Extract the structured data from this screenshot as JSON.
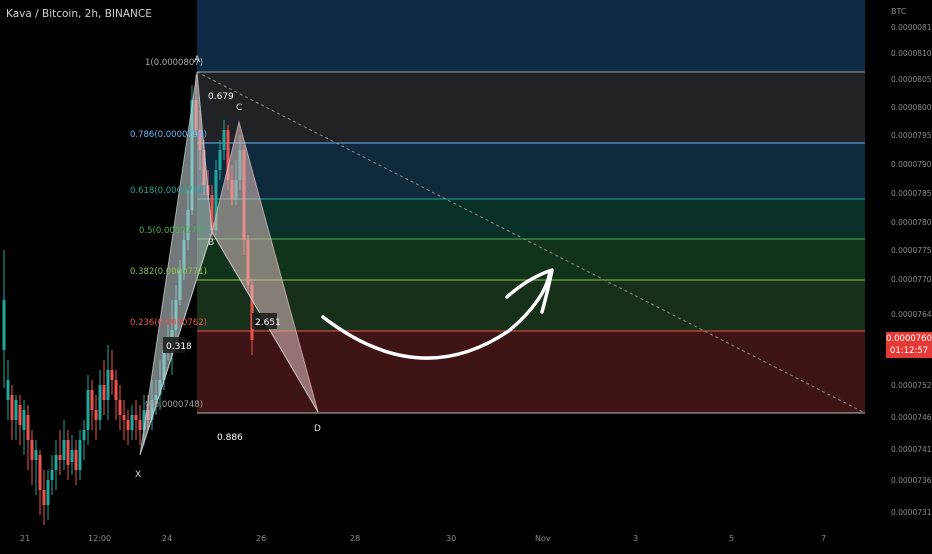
{
  "header": {
    "symbol_title": "Kava / Bitcoin, 2h, BINANCE"
  },
  "price_axis": {
    "currency": "BTC",
    "ticks": [
      "0.0000081",
      "0.0000810",
      "0.0000805",
      "0.0000800",
      "0.0000795",
      "0.0000790",
      "0.0000785",
      "0.0000780",
      "0.0000775",
      "0.0000770",
      "0.0000764",
      "0.0000752",
      "0.0000746",
      "0.0000741",
      "0.0000736",
      "0.0000731"
    ],
    "last_price": "0.0000760",
    "countdown": "01:12:57"
  },
  "time_axis": {
    "ticks": [
      "21",
      "12:00",
      "24",
      "26",
      "28",
      "30",
      "Nov",
      "3",
      "5",
      "7"
    ]
  },
  "fib_levels": [
    {
      "label": "1(0.0000807)",
      "color": "#b0b0b0"
    },
    {
      "label": "0.786(0.0000794)",
      "color": "#64b5f6"
    },
    {
      "label": "0.618(0.0000784)",
      "color": "#26a69a"
    },
    {
      "label": "0.5(0.0000777)",
      "color": "#4caf50"
    },
    {
      "label": "0.382(0.0000771)",
      "color": "#8bc34a"
    },
    {
      "label": "0.236(0.0000762)",
      "color": "#ef5350"
    },
    {
      "label": "0(0.0000748)",
      "color": "#9e9e9e"
    }
  ],
  "pattern": {
    "points": {
      "X": "X",
      "A": "A",
      "B": "B",
      "C": "C",
      "D": "D"
    },
    "ratios": {
      "ab": "0.679",
      "bc": "0.318",
      "cd": "2.651",
      "xd": "0.886"
    }
  },
  "chart_data": {
    "type": "candlestick",
    "symbol": "Kava / Bitcoin",
    "interval": "2h",
    "exchange": "BINANCE",
    "y_unit": "BTC",
    "ylim": [
      7.3e-05,
      8.13e-05
    ],
    "fibonacci_retracement": [
      {
        "ratio": 1,
        "price": 8.07e-05
      },
      {
        "ratio": 0.786,
        "price": 7.94e-05
      },
      {
        "ratio": 0.618,
        "price": 7.84e-05
      },
      {
        "ratio": 0.5,
        "price": 7.77e-05
      },
      {
        "ratio": 0.382,
        "price": 7.71e-05
      },
      {
        "ratio": 0.236,
        "price": 7.62e-05
      },
      {
        "ratio": 0,
        "price": 7.48e-05
      }
    ],
    "harmonic_pattern": {
      "points": [
        "X",
        "A",
        "B",
        "C",
        "D"
      ],
      "ratios": {
        "AB": 0.679,
        "BC": 0.318,
        "CD": 2.651,
        "XD": 0.886
      }
    },
    "last_price": 7.6e-05,
    "colors": {
      "up": "#26a69a",
      "down": "#ef5350",
      "pattern_fill": "#cfd8dc",
      "arrow": "#ffffff"
    }
  }
}
